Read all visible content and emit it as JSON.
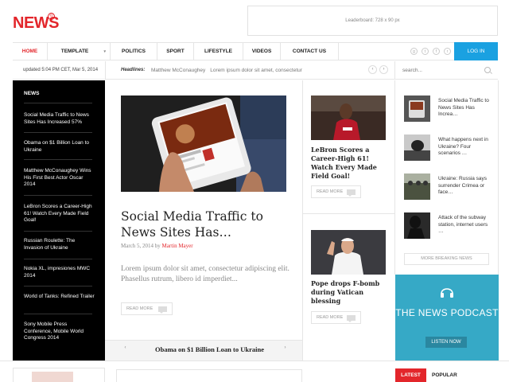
{
  "header": {
    "logo": "NEWS",
    "logo_mark": "®",
    "leaderboard": "Leaderboard: 728 x 90 px"
  },
  "nav": {
    "items": [
      {
        "label": "HOME"
      },
      {
        "label": "TEMPLATE"
      },
      {
        "label": "POLITICS"
      },
      {
        "label": "SPORT"
      },
      {
        "label": "LIFESTYLE"
      },
      {
        "label": "VIDEOS"
      },
      {
        "label": "CONTACT US"
      }
    ],
    "social": [
      "google-plus-icon",
      "twitter-icon",
      "facebook-icon",
      "rss-icon"
    ],
    "login": "LOG IN"
  },
  "ticker": {
    "updated": "updated 5:04 PM CET, Mar 5, 2014",
    "headlines_label": "Headlines:",
    "headline_1": "Matthew McConaughey",
    "headline_2": "Lorem ipsum dolor sit amet, consectetur",
    "search_placeholder": "search..."
  },
  "news_column": {
    "heading": "NEWS",
    "items": [
      {
        "text": "Social Media Traffic to News Sites Has Increased 57%"
      },
      {
        "text": "Obama on $1 Billion Loan to Ukraine"
      },
      {
        "text": "Matthew McConaughey Wins His First Best Actor Oscar 2014"
      },
      {
        "text": "LeBron Scores a Career-High 61! Watch Every Made Field Goal!"
      },
      {
        "text": "Russian Roulette: The Invasion of Ukraine"
      },
      {
        "text": "Nokia XL, impresiones MWC 2014"
      },
      {
        "text": "World of Tanks: Refined Trailer"
      },
      {
        "text": "Sony Mobile Press Conference, Mobile World Congress 2014"
      }
    ]
  },
  "featured": {
    "title": "Social Media Traffic to News Sites Has…",
    "date": "March 5, 2014 by",
    "author": "Martin Mayer",
    "excerpt": "Lorem ipsum dolor sit amet, consectetur adipiscing elit. Phasellus rutrum, libero id imperdiet...",
    "read_more": "READ MORE",
    "bottom_title": "Obama on $1 Billion Loan to Ukraine"
  },
  "cards": [
    {
      "title": "LeBron Scores a Career-High 61! Watch Every Made Field Goal!",
      "read_more": "READ MORE"
    },
    {
      "title": "Pope drops F-bomb during Vatican blessing",
      "read_more": "READ MORE"
    }
  ],
  "sidebar": {
    "items": [
      {
        "text": "Social Media Traffic to News Sites Has Increa…"
      },
      {
        "text": "What happens next in Ukraine? Four scenarios …"
      },
      {
        "text": "Ukraine: Russia says surrender Crimea or face…"
      },
      {
        "text": "Attack of the subway station, internet users …"
      }
    ],
    "more_breaking": "MORE BREAKING NEWS",
    "podcast_title": "THE NEWS PODCAST",
    "podcast_button": "LISTEN NOW",
    "tab_latest": "LATEST",
    "tab_popular": "POPULAR"
  },
  "colors": {
    "accent": "#e3262b",
    "login_blue": "#1aa1e1",
    "podcast_teal": "#36a9c6"
  }
}
